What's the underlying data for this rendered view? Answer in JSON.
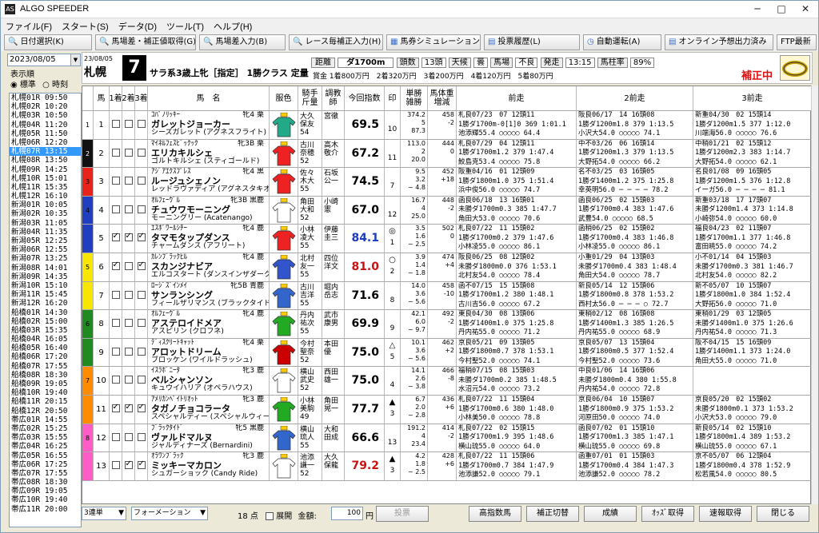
{
  "app": {
    "title": "ALGO SPEEDER",
    "icon": "AS"
  },
  "menu": [
    "ファイル(F)",
    "スタート(S)",
    "データ(D)",
    "ツール(T)",
    "ヘルプ(H)"
  ],
  "toolbar": [
    {
      "label": "日付選択(K)",
      "icon": "search-icon"
    },
    {
      "label": "馬場差・補正値取得(G)",
      "icon": "search-icon"
    },
    {
      "label": "馬場差入力(B)",
      "icon": "search-icon"
    },
    {
      "label": "レース毎補正入力(H)",
      "icon": "search-icon"
    },
    {
      "label": "馬券シミュレーション(B)",
      "icon": "grid-icon"
    },
    {
      "label": "投票履歴(L)",
      "icon": "doc-icon"
    },
    {
      "label": "自動運転(A)",
      "icon": "clock-icon"
    },
    {
      "label": "オンライン予想出力済み",
      "icon": "doc-icon"
    },
    {
      "label": "FTP最新",
      "icon": ""
    }
  ],
  "left": {
    "date": "2023/08/05",
    "order_label": "表示順",
    "opt1": "標準",
    "opt2": "時刻",
    "races": [
      "札幌01R 09:50",
      "札幌02R 10:20",
      "札幌03R 10:50",
      "札幌04R 11:20",
      "札幌05R 11:50",
      "札幌06R 12:20",
      "札幌07R 13:15",
      "札幌08R 13:50",
      "札幌09R 14:25",
      "札幌10R 15:01",
      "札幌11R 15:35",
      "札幌12R 16:10",
      "新潟01R 10:05",
      "新潟02R 10:35",
      "新潟03R 11:05",
      "新潟04R 11:35",
      "新潟05R 12:25",
      "新潟06R 12:55",
      "新潟07R 13:25",
      "新潟08R 14:01",
      "新潟09R 14:35",
      "新潟10R 15:10",
      "新潟11R 15:45",
      "新潟12R 16:20",
      "船橋01R 14:30",
      "船橋02R 15:00",
      "船橋03R 15:35",
      "船橋04R 16:05",
      "船橋05R 16:40",
      "船橋06R 17:20",
      "船橋07R 17:55",
      "船橋08R 18:30",
      "船橋09R 19:05",
      "船橋10R 19:40",
      "船橋11R 20:15",
      "船橋12R 20:50",
      "帯広01R 14:55",
      "帯広02R 15:25",
      "帯広03R 15:55",
      "帯広04R 16:25",
      "帯広05R 16:55",
      "帯広06R 17:25",
      "帯広07R 17:55",
      "帯広08R 18:30",
      "帯広09R 19:05",
      "帯広10R 19:40",
      "帯広11R 20:00"
    ],
    "selected": 6
  },
  "race": {
    "date": "23/08/05",
    "course": "札幌",
    "num": "7",
    "title": "サラ系3歳上牝［指定］ 1勝クラス 定量",
    "dist_label": "距離",
    "dist": "ダ1700m",
    "heads_label": "頭数",
    "heads": "13頭",
    "weather_label": "天候",
    "weather": "曇",
    "track_label": "馬場",
    "track": "不良",
    "post_label": "発走",
    "post": "13:15",
    "rate_label": "馬柱率",
    "rate": "89%",
    "prize": "賞金 1着800万円　2着320万円　3着200万円　4着120万円　5着80万円",
    "status": "補正中"
  },
  "headers": [
    "馬",
    "1着",
    "2着",
    "3着",
    "馬　名",
    "服色",
    "騎手\n斤量",
    "調教\n師",
    "今回指数",
    "印",
    "単勝\n雑勝",
    "馬体重\n増減",
    "前走",
    "2前走",
    "3前走"
  ],
  "horses": [
    {
      "w": "1",
      "n": "1",
      "c": [
        0,
        0,
        0
      ],
      "sire": "ｺﾊﾟﾉﾘｯｷｰ",
      "sex": "牝4 栗",
      "name": "ガレットジョーカー",
      "dam": "シーズガレット (アグネスフライト)",
      "jk": "大久\n保友\n54",
      "tr": "宮徹",
      "idx": "69.5",
      "idxc": "#000",
      "mk": "",
      "pop": "10",
      "odds": "374.2\n5\n87.3",
      "wt": "458\n-2",
      "p1": "札良07/23　07 12頭11\n1勝ダ1700m-0[1]0 369 1:01.1\n池添輝55.4 ○○○○○ 64.4",
      "p2": "阪良06/17　14 16頭08\n1勝ダ1200m1.8 379 1:13.5\n小沢大54.0 ○○○○○ 74.1",
      "p3": "新重04/30　02 15頭14\n1勝ダ1200m1.5 377 1:12.0\n川端海56.0 ○○○○○ 76.6"
    },
    {
      "w": "2",
      "n": "2",
      "c": [
        0,
        0,
        0
      ],
      "sire": "ﾏｲﾈﾙﾌｪｽﾋﾞｯｸｯｸ",
      "sex": "牝3B 栗",
      "name": "エリカキルシェ",
      "dam": "ゴルトキルシェ (スティゴールド)",
      "jk": "古川\n奈穂\n52",
      "tr": "高木\n敬介",
      "idx": "67.2",
      "idxc": "#000",
      "mk": "",
      "pop": "11",
      "odds": "113.0\n2\n20.0",
      "wt": "444\n0",
      "p1": "札良07/29　04 12頭11\n1勝ダ1700m1.2 379 1:47.4\n鮫島克53.4 ○○○○○ 75.8",
      "p2": "中不03/26　06 16頭14\n1勝ダ1200m1.3 379 1:13.5\n大野拓54.0 ○○○○○ 66.2",
      "p3": "中稍01/21　02 15頭12\n1勝ダ1200m2.3 383 1:14.7\n大野拓54.0 ○○○○○ 62.1"
    },
    {
      "w": "3",
      "n": "3",
      "c": [
        0,
        0,
        0
      ],
      "sire": "ｱｼﾞｱｴｸｽﾌﾟﾚｽ",
      "sex": "牝4 黒",
      "name": "ルージュシェノン",
      "dam": "レッドラヴァディア (アグネスタキオン)",
      "jk": "佐々\n木大\n55",
      "tr": "石坂\n公一",
      "idx": "74.5",
      "idxc": "#000",
      "mk": "",
      "pop": "7",
      "odds": "9.5\n3.2\n~ 4.8",
      "wt": "452\n+18",
      "p1": "阪重04/16　01 12頭09\n1勝ダ1800m1.0 375 1:51.4\n浜中俊56.0 ○○○○○ 74.7",
      "p2": "名不03/25　03 16頭05\n1勝ダ1400m1.2 375 1:25.8\n幸英明56.0 ─ ─ ─ ─ 78.2",
      "p3": "名良01/08　09 16頭05\n1勝ダ1200m1.5 376 1:12.8\nイーガ56.0 ─ ─ ─ ─ 81.1"
    },
    {
      "w": "4",
      "n": "4",
      "c": [
        0,
        0,
        0
      ],
      "sire": "ｵﾙﾌｪｰｳﾞﾙ",
      "sex": "牝3B 黒鹿",
      "name": "チュウワモーニング",
      "dam": "モーニングリー (Acatenango)",
      "jk": "角田\n大和\n52",
      "tr": "小崎\n憲",
      "idx": "67.0",
      "idxc": "#000",
      "mk": "",
      "pop": "12",
      "odds": "16.7\n4\n25.0",
      "wt": "448\n-2",
      "p1": "函良06/18　13 16頭01\n未勝ダ1700m0.3 385 1:47.7\n角田大53.0 ○○○○○ 70.6",
      "p2": "函良06/25　02 15頭03\n1勝ダ1700m0.4 383 1:47.6\n武豊54.0 ○○○○○ 68.5",
      "p3": "新重03/18　17 17頭07\n未勝ダ1200m1.4 373 1:14.8\n小崎弥54.0 ○○○○○ 60.0"
    },
    {
      "w": "4",
      "n": "5",
      "c": [
        1,
        1,
        1
      ],
      "sire": "ｴｽﾎﾟﾜｰﾙｼﾁｰ",
      "sex": "牝4 鹿",
      "name": "タマモタップダンス",
      "dam": "チャームダンス (アフリート)",
      "jk": "小林\n凌大\n55",
      "tr": "伊藤\n圭三",
      "idx": "84.1",
      "idxc": "#1a3cc0",
      "mk": "◎",
      "pop": "1",
      "odds": "3.5\n1.6\n~ 2.5",
      "wt": "502\n0",
      "p1": "札良07/22　11 15頭02\n1勝ダ1700m0.2 379 1:47.6\n小林凌55.0 ○○○○○ 86.1",
      "p2": "函稍06/25　02 15頭02\n1勝ダ1700m0.4 383 1:46.8\n小林凌55.0 ○○○○○ 86.1",
      "p3": "福良04/23　02 11頭07\n1勝ダ1700m1.1 377 1:46.8\n富田暁55.0 ○○○○○ 74.2"
    },
    {
      "w": "5",
      "n": "6",
      "c": [
        1,
        0,
        1
      ],
      "sire": "ｶﾚﾝﾌﾞﾗｯｸﾋﾙ",
      "sex": "牝4 鹿",
      "name": "スカンジナビア",
      "dam": "エルコスタート (ダンスインザダーク)",
      "jk": "北村\n友一\n55",
      "tr": "四位\n洋文",
      "idx": "81.0",
      "idxc": "#cc1111",
      "mk": "○",
      "pop": "2",
      "odds": "3.9\n1.4\n~ 1.8",
      "wt": "474\n+4",
      "p1": "阪良06/25　08 12頭02\n未勝ダ1800m0.0 376 1:53.1\n北村友54.0 ○○○○○ 78.4",
      "p2": "小重01/29　04 13頭03\n未勝ダ1700m0.4 383 1:48.4\n角田大54.0 ○○○○○ 78.7",
      "p3": "小不01/14　04 15頭03\n未勝ダ1700m0.3 381 1:46.7\n北村友54.0 ○○○○○ 82.2"
    },
    {
      "w": "5",
      "n": "7",
      "c": [
        0,
        0,
        0
      ],
      "sire": "ﾛｰｼﾞｽﾞｲﾝﾒｲ",
      "sex": "牝5B 青鹿",
      "name": "サンランシング",
      "dam": "フィールザリマンス (ブラックタイド)",
      "jk": "古川\n吉洋\n55",
      "tr": "堀内\n岳志",
      "idx": "71.6",
      "idxc": "#000",
      "mk": "",
      "pop": "8",
      "odds": "14.0\n3.6\n~ 5.6",
      "wt": "458\n-10",
      "p1": "函不07/15　15 15頭08\n1勝ダ1700m1.2 380 1:48.1\n古川吉56.0 ○○○○○ 67.2",
      "p2": "新良05/14　12 15頭06\n1勝ダ1800m0.8 378 1:53.2\n西村太56.0 ─ ─ ─ ○ 72.7",
      "p3": "新不05/07　10 15頭07\n1勝ダ1800m1.0 384 1:52.4\n大野拓56.0 ○○○○○ 71.0"
    },
    {
      "w": "6",
      "n": "8",
      "c": [
        0,
        0,
        0
      ],
      "sire": "ｵﾙﾌｪｰｳﾞﾙ",
      "sex": "牝4 鹿",
      "name": "アステロイドメア",
      "dam": "アスピリン (クロフネ)",
      "jk": "丹内\n祐次\n55",
      "tr": "武市\n康男",
      "idx": "69.9",
      "idxc": "#000",
      "mk": "",
      "pop": "9",
      "odds": "42.1\n6.0\n~ 9.7",
      "wt": "492\n-2",
      "p1": "東良04/30　08 13頭06\n1勝ダ1400m1.0 375 1:25.8\n丹内祐55.0 ○○○○○ 71.2",
      "p2": "東稍02/12　08 16頭08\n1勝ダ1400m1.3 385 1:26.5\n丹内祐55.0 ○○○○○ 68.9",
      "p3": "東稍01/29　03 12頭05\n未勝ダ1400m1.0 375 1:26.6\n丹内祐54.0 ○○○○○ 71.3"
    },
    {
      "w": "6",
      "n": "9",
      "c": [
        0,
        0,
        0
      ],
      "sire": "ﾃﾞｨｽｸﾘｰﾄｷｬｯﾄ",
      "sex": "牝4 栗",
      "name": "アロットドリーム",
      "dam": "ブロッケン (ワイルドラッシュ)",
      "jk": "今村\n聖奈\n52",
      "tr": "本田\n優",
      "idx": "75.0",
      "idxc": "#000",
      "mk": "△",
      "pop": "5",
      "odds": "10.1\n3.6\n~ 5.6",
      "wt": "462\n+2",
      "p1": "京良05/21　09 13頭05\n1勝ダ1800m0.7 378 1:53.1\n今村聖52.0 ○○○○○ 74.1",
      "p2": "京良05/07　13 15頭04\n1勝ダ1800m0.5 377 1:52.4\n今村聖52.0 ○○○○○ 73.6",
      "p3": "阪不04/15　15 16頭09\n1勝ダ1400m1.1 373 1:24.0\n角田大55.0 ○○○○○ 71.0"
    },
    {
      "w": "7",
      "n": "10",
      "c": [
        0,
        0,
        0
      ],
      "sire": "ｲｽﾗﾎﾞﾆｰﾀ",
      "sex": "牝3 鹿",
      "name": "ベルシャンソン",
      "dam": "キュウイハリア (オペラハウス)",
      "jk": "横山\n武史\n52",
      "tr": "西田\n雄一",
      "idx": "75.0",
      "idxc": "#000",
      "mk": "",
      "pop": "4",
      "odds": "14.1\n2.6\n~ 3.8",
      "wt": "466\n-8",
      "p1": "福稍07/15　08 15頭03\n未勝ダ1700m0.2 385 1:48.5\n水沼元54.0 ○○○○○ 73.2",
      "p2": "中良01/06　14 16頭06\n未勝ダ1800m0.4 380 1:55.8\n丹内祐54.0 ○○○○○ 72.8",
      "p3": ""
    },
    {
      "w": "7",
      "n": "11",
      "c": [
        1,
        1,
        1
      ],
      "sire": "ｱﾒﾘｶﾝﾍﾟｲﾄﾘｵｯﾄ",
      "sex": "牝3 鹿",
      "name": "タガノチョコラータ",
      "dam": "スペシャルティー (スペシャルウィーク)",
      "jk": "小林\n美駒\n49",
      "tr": "角田\n晃一",
      "idx": "77.7",
      "idxc": "#000",
      "mk": "▲",
      "pop": "3",
      "odds": "6.7\n2.0\n~ 2.8",
      "wt": "436\n+6",
      "p1": "札良07/22　11 15頭04\n1勝ダ1700m0.6 380 1:48.0\n小林美50.0 ○○○○○ 78.8",
      "p2": "京良06/04　10 15頭07\n1勝ダ1800m0.9 375 1:53.2\n河原田50.0 ○○○○○ 74.0",
      "p3": "京良05/20　02 15頭02\n未勝ダ1800m0.1 373 1:53.2\n小沢大53.0 ○○○○○ 79.0"
    },
    {
      "w": "8",
      "n": "12",
      "c": [
        0,
        0,
        0
      ],
      "sire": "ﾌﾞﾗｯｸﾀｲﾄﾞ",
      "sex": "牝5 黒鹿",
      "name": "ヴァルドマルヌ",
      "dam": "ジャルディナーズ (Bernardini)",
      "jk": "横山\n琉人\n55",
      "tr": "大和\n田成",
      "idx": "66.6",
      "idxc": "#000",
      "mk": "",
      "pop": "13",
      "odds": "191.2\n4\n23.4",
      "wt": "414\n-2",
      "p1": "札良07/22　02 15頭15\n1勝ダ1700m1.9 395 1:48.6\n横山琉55.0 ○○○○○ 64.0",
      "p2": "函良07/02　01 15頭10\n1勝ダ1700m1.3 385 1:47.1\n横山琉55.0 ○○○○○ 69.8",
      "p3": "新良05/14　02 15頭10\n1勝ダ1800m1.4 389 1:53.2\n横山琉55.0 ○○○○○ 67.1"
    },
    {
      "w": "8",
      "n": "13",
      "c": [
        0,
        1,
        1
      ],
      "sire": "ｵﾗﾜﾝﾌﾞﾗｯｸ",
      "sex": "牝3 鹿",
      "name": "ミッキーマカロン",
      "dam": "シュガーショック (Candy Ride)",
      "jk": "池添\n謙一\n52",
      "tr": "大久\n保龍",
      "idx": "79.2",
      "idxc": "#cc1111",
      "mk": "▲",
      "pop": "3",
      "odds": "4.2\n1.8\n~ 2.5",
      "wt": "428\n+6",
      "p1": "札良07/22　11 15頭06\n1勝ダ1700m0.7 384 1:47.9\n池添謙52.0 ○○○○○ 79.1",
      "p2": "函重07/01　01 15頭03\n1勝ダ1700m0.4 384 1:47.3\n池添謙52.0 ○○○○○ 78.2",
      "p3": "京不05/07　06 12頭04\n1勝ダ1800m0.4 378 1:52.9\n松若風54.0 ○○○○○ 80.5"
    }
  ],
  "waku_colors": {
    "1": "#ffffff",
    "2": "#111111",
    "3": "#e8231b",
    "4": "#1f3fbf",
    "5": "#f7e700",
    "6": "#1f8a1f",
    "7": "#ff8c00",
    "8": "#ff5cc8"
  },
  "bottom": {
    "bet_type": "3連単",
    "form": "フォーメーション",
    "points": "18",
    "pt_unit": "点",
    "expand": "展開",
    "amount_label": "金額:",
    "amount": "100",
    "yen": "円",
    "vote": "投票",
    "b1": "高指数馬",
    "b2": "補正切替",
    "b3": "成績",
    "b4": "ｵｯｽﾞ取得",
    "b5": "速報取得",
    "b6": "閉じる"
  }
}
